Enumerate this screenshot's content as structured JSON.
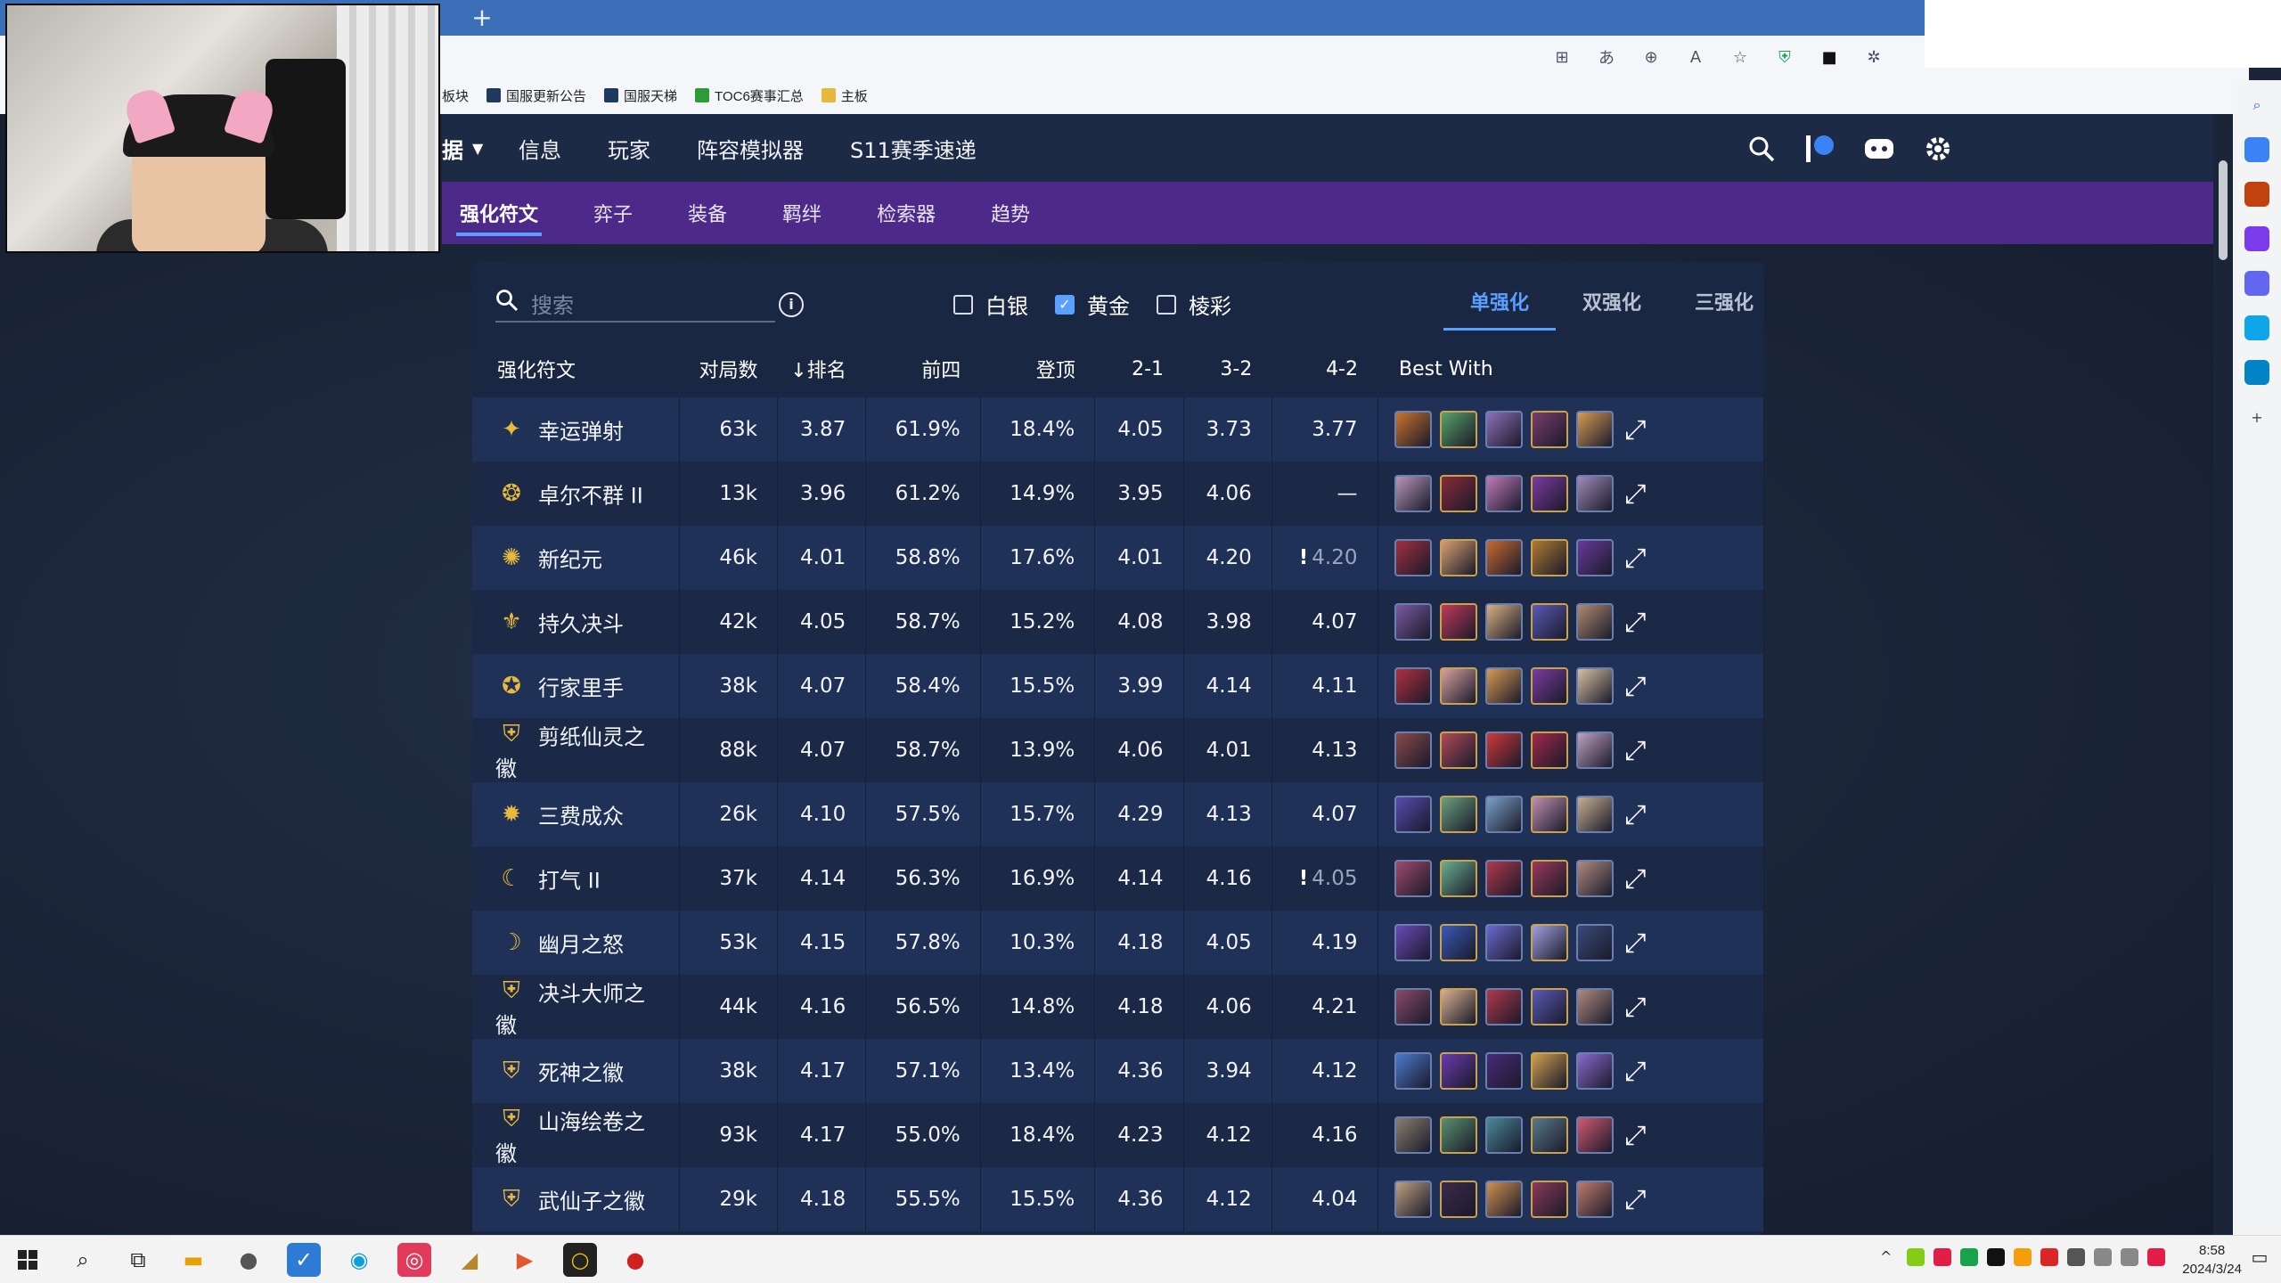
{
  "browser": {
    "new_tab": "+",
    "bookmarks": [
      {
        "label": "板块",
        "color": "#2c2c2c"
      },
      {
        "label": "国服更新公告",
        "color": "#1f3a5f"
      },
      {
        "label": "国服天梯",
        "color": "#1f3a5f"
      },
      {
        "label": "TOC6赛事汇总",
        "color": "#2e9b3a"
      },
      {
        "label": "主板",
        "color": "#e6b93d"
      }
    ]
  },
  "sitenav": {
    "dropdown_label": "据",
    "items": [
      "信息",
      "玩家",
      "阵容模拟器",
      "S11赛季速递"
    ]
  },
  "subnav": {
    "items": [
      "强化符文",
      "弈子",
      "装备",
      "羁绊",
      "检索器",
      "趋势"
    ]
  },
  "toolbar": {
    "search_placeholder": "搜索",
    "filters": [
      {
        "label": "白银",
        "checked": false
      },
      {
        "label": "黄金",
        "checked": true
      },
      {
        "label": "棱彩",
        "checked": false
      }
    ],
    "modes": [
      "单强化",
      "双强化",
      "三强化"
    ],
    "active_mode": "单强化"
  },
  "table": {
    "headers": [
      "强化符文",
      "对局数",
      "↓排名",
      "前四",
      "登顶",
      "2-1",
      "3-2",
      "4-2",
      "Best With"
    ],
    "rows": [
      {
        "name": "幸运弹射",
        "games": "63k",
        "rank": "3.87",
        "top4": "61.9%",
        "win": "18.4%",
        "s21": "4.05",
        "s32": "3.73",
        "s42": "3.77",
        "s42_warn": false,
        "champs": [
          "#c9742b",
          "#5aa36a",
          "#8f6fb8",
          "#7a3d6e",
          "#d89b52"
        ]
      },
      {
        "name": "卓尔不群 II",
        "games": "13k",
        "rank": "3.96",
        "top4": "61.2%",
        "win": "14.9%",
        "s21": "3.95",
        "s32": "4.06",
        "s42": "—",
        "s42_warn": false,
        "champs": [
          "#b996b8",
          "#8a2a3a",
          "#c07ab8",
          "#7a3aa0",
          "#a08ab8"
        ]
      },
      {
        "name": "新纪元",
        "games": "46k",
        "rank": "4.01",
        "top4": "58.8%",
        "win": "17.6%",
        "s21": "4.01",
        "s32": "4.20",
        "s42": "4.20",
        "s42_warn": true,
        "champs": [
          "#a23040",
          "#d8a070",
          "#c86a30",
          "#b07a30",
          "#6a3a9a"
        ]
      },
      {
        "name": "持久决斗",
        "games": "42k",
        "rank": "4.05",
        "top4": "58.7%",
        "win": "15.2%",
        "s21": "4.08",
        "s32": "3.98",
        "s42": "4.07",
        "s42_warn": false,
        "champs": [
          "#7a5aa0",
          "#c03a5a",
          "#d8b080",
          "#5a5ab8",
          "#b08a70"
        ]
      },
      {
        "name": "行家里手",
        "games": "38k",
        "rank": "4.07",
        "top4": "58.4%",
        "win": "15.5%",
        "s21": "3.99",
        "s32": "4.14",
        "s42": "4.11",
        "s42_warn": false,
        "champs": [
          "#b03040",
          "#d8a0a0",
          "#d89a50",
          "#7a3aa0",
          "#d8c0a0"
        ]
      },
      {
        "name": "剪纸仙灵之徽",
        "games": "88k",
        "rank": "4.07",
        "top4": "58.7%",
        "win": "13.9%",
        "s21": "4.06",
        "s32": "4.01",
        "s42": "4.13",
        "s42_warn": false,
        "champs": [
          "#8a4a4a",
          "#b04a5a",
          "#d03a3a",
          "#a02a4a",
          "#c0a0c0"
        ]
      },
      {
        "name": "三费成众",
        "games": "26k",
        "rank": "4.10",
        "top4": "57.5%",
        "win": "15.7%",
        "s21": "4.29",
        "s32": "4.13",
        "s42": "4.07",
        "s42_warn": false,
        "champs": [
          "#5a4ab0",
          "#6aa080",
          "#7aa0c8",
          "#c090b0",
          "#c8b090"
        ]
      },
      {
        "name": "打气 II",
        "games": "37k",
        "rank": "4.14",
        "top4": "56.3%",
        "win": "16.9%",
        "s21": "4.14",
        "s32": "4.16",
        "s42": "4.05",
        "s42_warn": true,
        "champs": [
          "#a04a6a",
          "#6ab090",
          "#b03a4a",
          "#9a3a5a",
          "#b08a80"
        ]
      },
      {
        "name": "幽月之怒",
        "games": "53k",
        "rank": "4.15",
        "top4": "57.8%",
        "win": "10.3%",
        "s21": "4.18",
        "s32": "4.05",
        "s42": "4.19",
        "s42_warn": false,
        "champs": [
          "#6a4ab8",
          "#3a5ab8",
          "#6a6ad0",
          "#a0a0e0",
          "#3a4a7a"
        ]
      },
      {
        "name": "决斗大师之徽",
        "games": "44k",
        "rank": "4.16",
        "top4": "56.5%",
        "win": "14.8%",
        "s21": "4.18",
        "s32": "4.06",
        "s42": "4.21",
        "s42_warn": false,
        "champs": [
          "#8a4a6a",
          "#d8b090",
          "#b03a4a",
          "#5a5ab8",
          "#b08a80"
        ]
      },
      {
        "name": "死神之徽",
        "games": "38k",
        "rank": "4.17",
        "top4": "57.1%",
        "win": "13.4%",
        "s21": "4.36",
        "s32": "3.94",
        "s42": "4.12",
        "s42_warn": false,
        "champs": [
          "#4a7ad0",
          "#6a3ab0",
          "#4a2a7a",
          "#d0a050",
          "#8a6ad0"
        ]
      },
      {
        "name": "山海绘卷之徽",
        "games": "93k",
        "rank": "4.17",
        "top4": "55.0%",
        "win": "18.4%",
        "s21": "4.23",
        "s32": "4.12",
        "s42": "4.16",
        "s42_warn": false,
        "champs": [
          "#8a8070",
          "#5a9070",
          "#4a8a9a",
          "#5a7a8a",
          "#d05a70"
        ]
      },
      {
        "name": "武仙子之徽",
        "games": "29k",
        "rank": "4.18",
        "top4": "55.5%",
        "win": "15.5%",
        "s21": "4.36",
        "s32": "4.12",
        "s42": "4.04",
        "s42_warn": false,
        "champs": [
          "#c0a080",
          "#3a2a4a",
          "#d09050",
          "#8a3a5a",
          "#c07a6a"
        ]
      }
    ]
  },
  "taskbar": {
    "time": "8:58",
    "date": "2024/3/24"
  }
}
